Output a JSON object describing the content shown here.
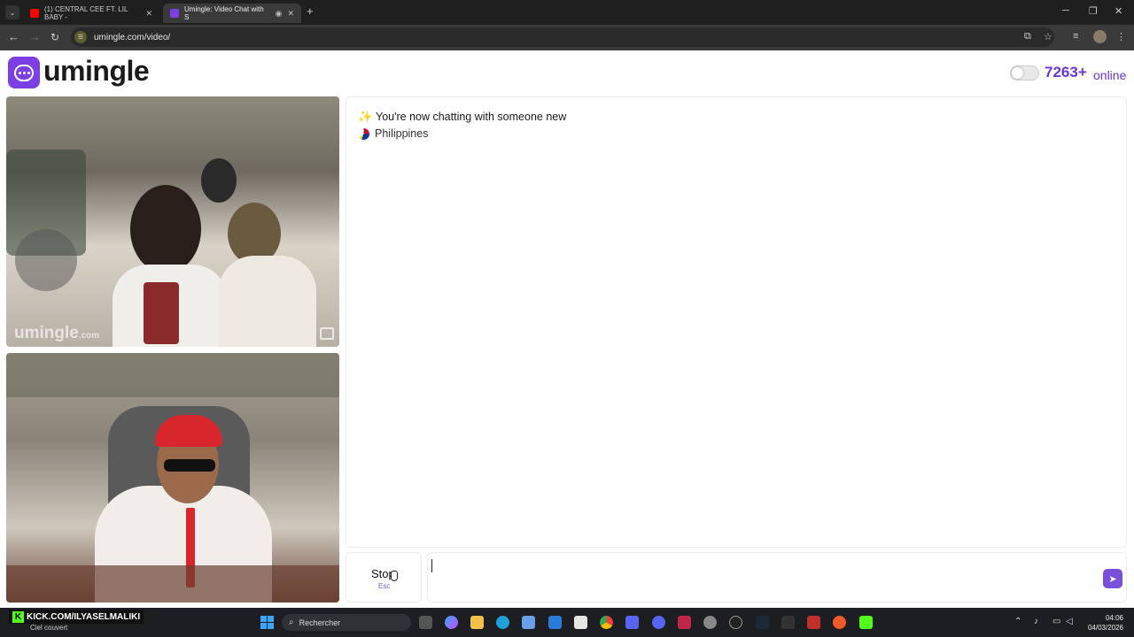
{
  "browser": {
    "tabs": [
      {
        "title": "(1) CENTRAL CEE FT. LIL BABY -",
        "favicon_color": "#ff0000",
        "active": false
      },
      {
        "title": "Umingle: Video Chat with S",
        "favicon_color": "#7b3fe4",
        "active": true
      }
    ],
    "url": "umingle.com/video/"
  },
  "header": {
    "logo_text": "umingle",
    "online_count": "7263+",
    "online_label": "online"
  },
  "videos": {
    "watermark_main": "umingle",
    "watermark_suffix": ".com"
  },
  "chat": {
    "status_message": "You're now chatting with someone new",
    "country": "Philippines"
  },
  "controls": {
    "stop_label": "Stop",
    "stop_hint": "Esc",
    "message_placeholder": ""
  },
  "taskbar": {
    "stream_banner": "KICK.COM/ILYASELMALIKI",
    "weather": "Ciel couvert",
    "search_placeholder": "Rechercher",
    "time": "04:06",
    "date": "04/03/2026"
  },
  "colors": {
    "brand": "#7b3fe4",
    "online_text": "#6a35d9"
  }
}
